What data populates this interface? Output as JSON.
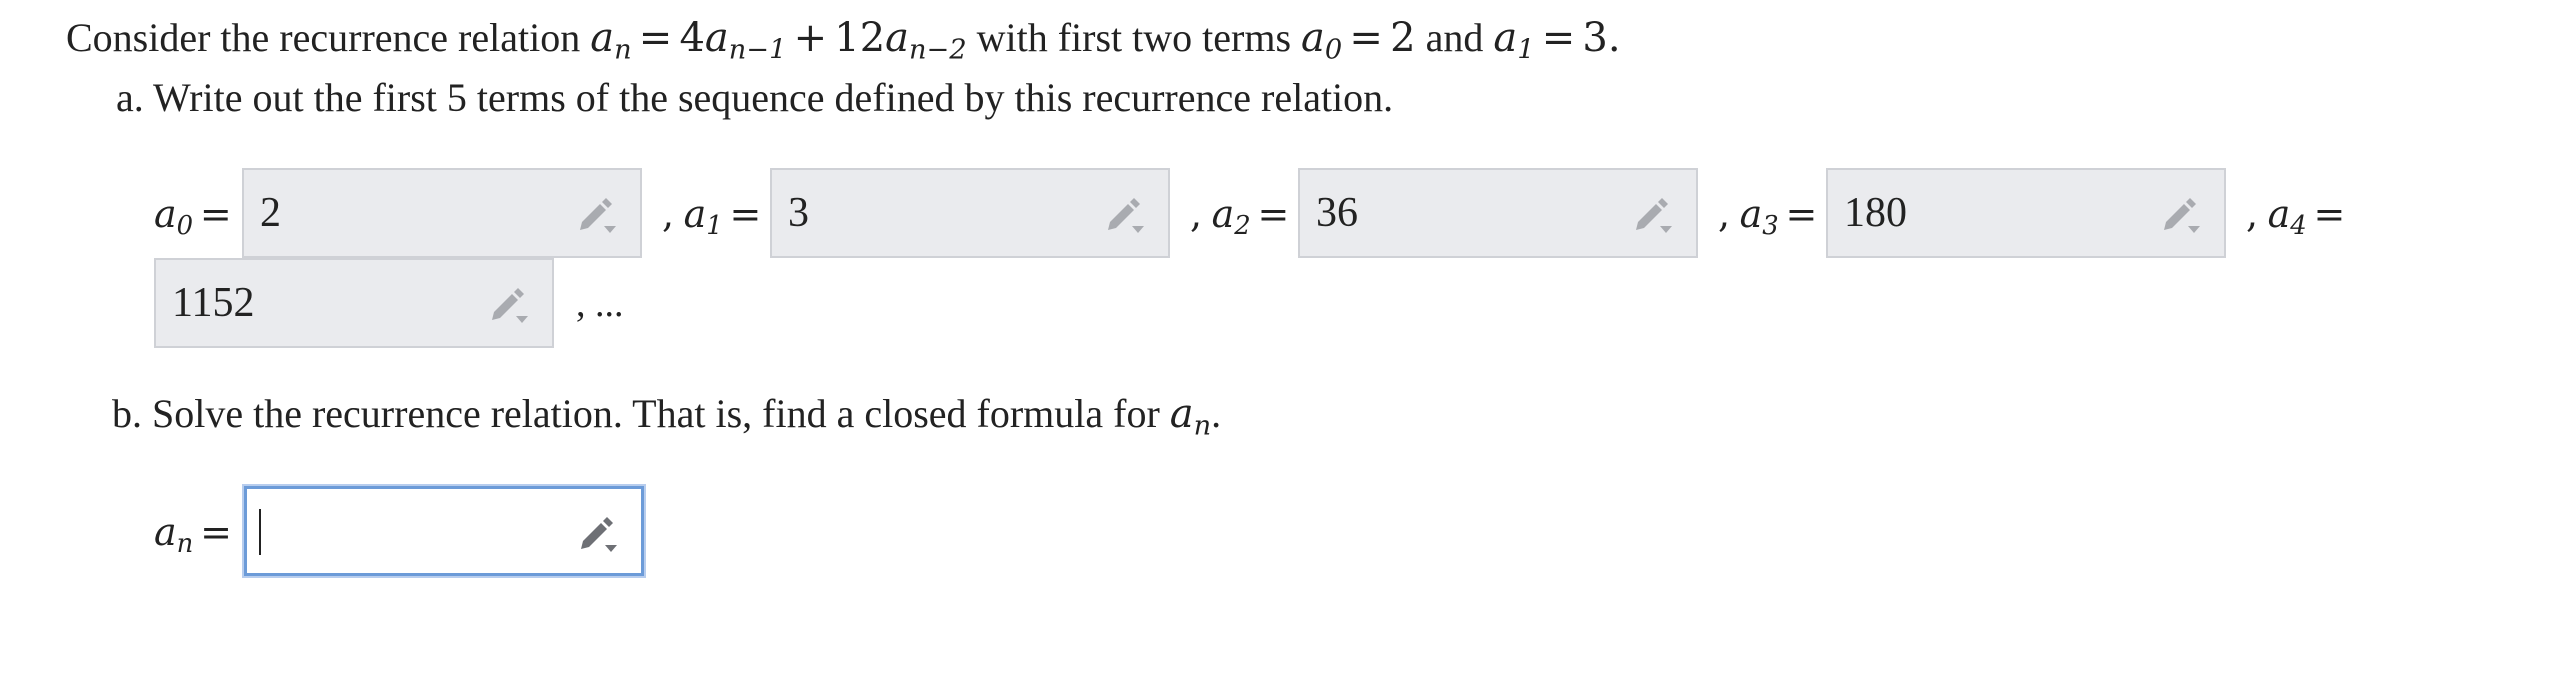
{
  "problem": {
    "intro_text": "Consider the recurrence relation",
    "recurrence_lhs": "a",
    "recurrence_lhs_sub": "n",
    "recurrence_eq": "=",
    "term1_coef": "4",
    "term1_var": "a",
    "term1_sub": "n−1",
    "plus": "+",
    "term2_coef": "12",
    "term2_var": "a",
    "term2_sub": "n−2",
    "with_text": "with first two terms",
    "a0_var": "a",
    "a0_sub": "0",
    "a0_eq": "=",
    "a0_val": "2",
    "and_text": "and",
    "a1_var": "a",
    "a1_sub": "1",
    "a1_eq": "=",
    "a1_val": "3."
  },
  "part_a": {
    "label": "a. Write out the first 5 terms of the sequence defined by this recurrence relation.",
    "terms": [
      {
        "var": "a",
        "sub": "0",
        "eq": "=",
        "prefix": "",
        "value": "2"
      },
      {
        "var": "a",
        "sub": "1",
        "eq": "=",
        "prefix": ",",
        "value": "3"
      },
      {
        "var": "a",
        "sub": "2",
        "eq": "=",
        "prefix": ",",
        "value": "36"
      },
      {
        "var": "a",
        "sub": "3",
        "eq": "=",
        "prefix": ",",
        "value": "180"
      },
      {
        "var": "a",
        "sub": "4",
        "eq": "=",
        "prefix": ",",
        "value": "1152"
      }
    ],
    "trailing": ", ..."
  },
  "part_b": {
    "label_text": "b. Solve the recurrence relation. That is, find a closed formula for",
    "label_var": "a",
    "label_sub": "n",
    "label_end": ".",
    "answer_var": "a",
    "answer_sub": "n",
    "answer_eq": "=",
    "answer_value": ""
  },
  "icons": {
    "field_tool": "pencil-dropdown-icon"
  },
  "colors": {
    "filled_field_bg": "#eaebee",
    "active_field_border": "#6c9bd8",
    "text": "#222222"
  }
}
